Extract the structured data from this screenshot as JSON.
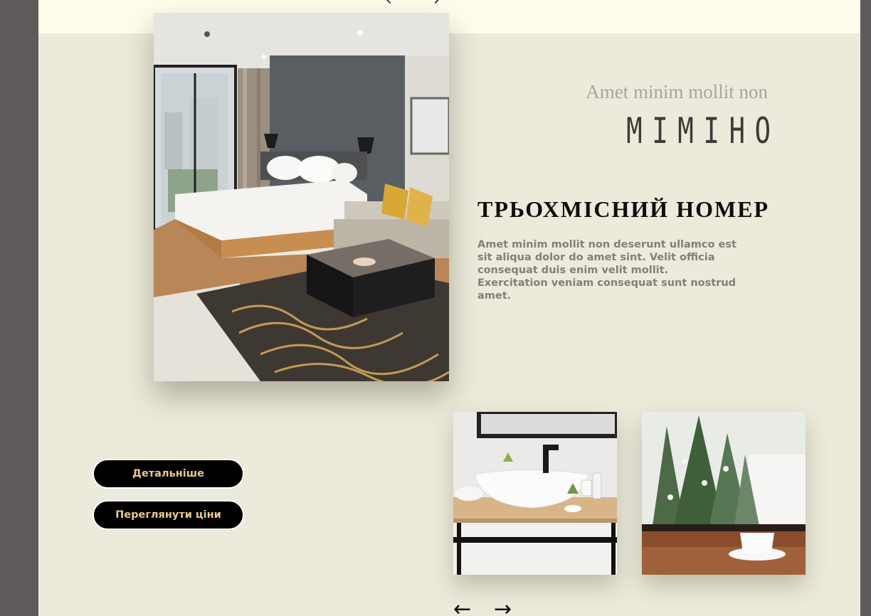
{
  "header": {
    "nav_prev": "‹",
    "nav_next": "›"
  },
  "hero": {
    "kicker": "Amet minim mollit non",
    "brand": "MIMIHO",
    "room_title": "ТРЬОХМІСНИЙ НОМЕР",
    "description": "Amet minim mollit non deserunt ullamco est sit aliqua dolor do amet sint. Velit officia consequat duis enim velit mollit. Exercitation veniam consequat sunt nostrud amet."
  },
  "buttons": {
    "details_label": "Детальніше",
    "prices_label": "Переглянути ціни"
  },
  "gallery": {
    "prev_label": "←",
    "next_label": "→"
  },
  "colors": {
    "page_bg": "#eceadb",
    "outer_bg": "#5f5a59",
    "header_bg": "#fffdec",
    "button_bg": "#000000",
    "button_text": "#e9c88e"
  }
}
